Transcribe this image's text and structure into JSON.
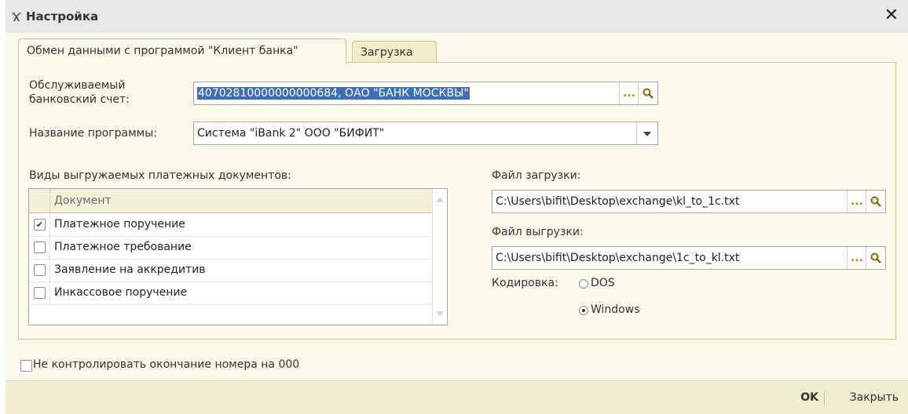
{
  "window": {
    "title": "Настройка",
    "close_symbol": "✕"
  },
  "tabs": [
    {
      "label": "Обмен данными с программой \"Клиент банка\"",
      "active": true
    },
    {
      "label": "Загрузка",
      "active": false
    }
  ],
  "account": {
    "label_line1": "Обслуживаемый",
    "label_line2": "банковский счет:",
    "value": "40702810000000000684, ОАО \"БАНК МОСКВЫ\""
  },
  "program": {
    "label": "Название программы:",
    "value": "Система \"iBank 2\" ООО \"БИФИТ\""
  },
  "documents": {
    "label": "Виды выгружаемых платежных документов:",
    "column_header": "Документ",
    "rows": [
      {
        "label": "Платежное поручение",
        "checked": true
      },
      {
        "label": "Платежное требование",
        "checked": false
      },
      {
        "label": "Заявление на аккредитив",
        "checked": false
      },
      {
        "label": "Инкассовое поручение",
        "checked": false
      }
    ]
  },
  "import_file": {
    "label": "Файл загрузки:",
    "value": "C:\\Users\\bifit\\Desktop\\exchange\\kl_to_1c.txt"
  },
  "export_file": {
    "label": "Файл выгрузки:",
    "value": "C:\\Users\\bifit\\Desktop\\exchange\\1c_to_kl.txt"
  },
  "encoding": {
    "label": "Кодировка:",
    "options": [
      "DOS",
      "Windows"
    ],
    "selected": "Windows"
  },
  "buttons": {
    "choose": "...",
    "checkmark": "✔"
  },
  "no_check_000": {
    "label": "Не контролировать окончание номера на 000",
    "checked": false
  },
  "footer": {
    "ok_label": "OK",
    "close_label": "Закрыть"
  },
  "colors": {
    "selection": "#3d6fb8",
    "panel_bg": "#fbf9ea",
    "titlebar_bg": "#e8e8e8"
  }
}
